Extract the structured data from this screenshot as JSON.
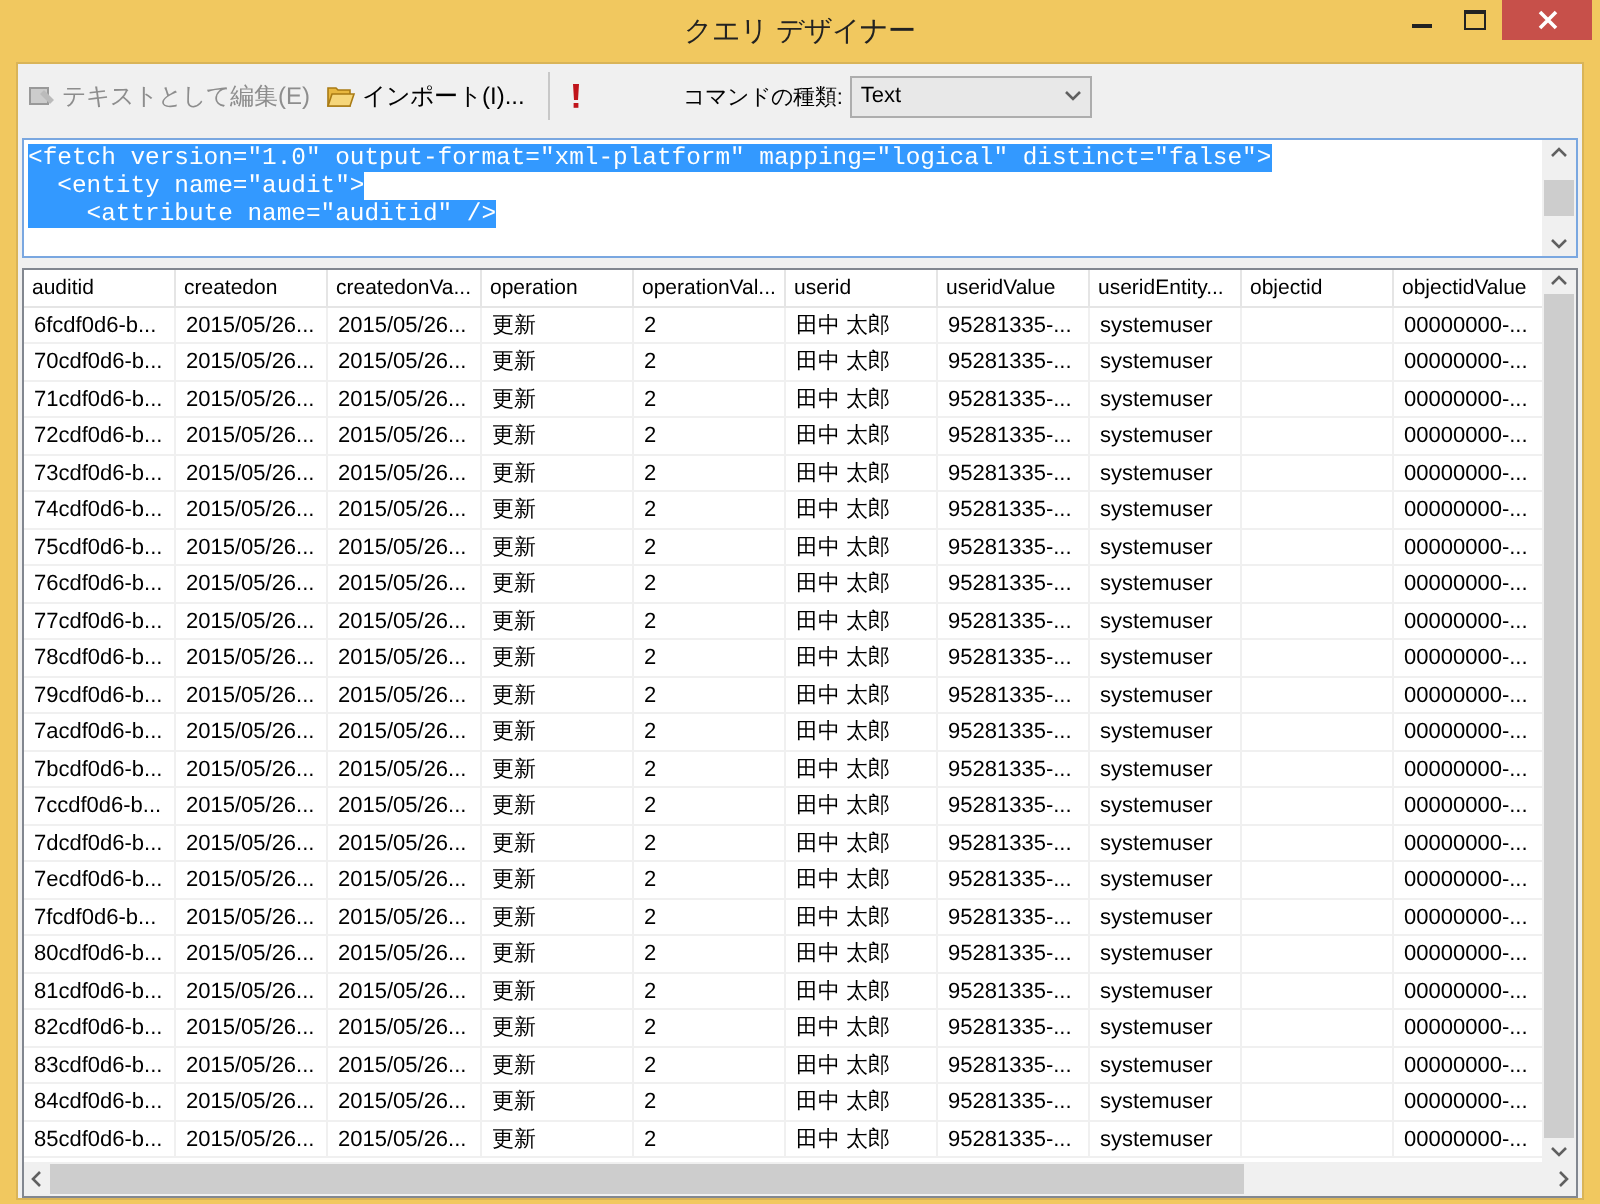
{
  "window": {
    "title": "クエリ デザイナー"
  },
  "toolbar": {
    "buttons": [
      {
        "label": "テキストとして編集(E)",
        "disabled": true
      },
      {
        "label": "インポート(I)...",
        "disabled": false
      }
    ],
    "command_type_label": "コマンドの種類:",
    "command_type_value": "Text"
  },
  "code_editor": {
    "selected": true,
    "lines": [
      "<fetch version=\"1.0\" output-format=\"xml-platform\" mapping=\"logical\" distinct=\"false\">",
      "  <entity name=\"audit\">",
      "    <attribute name=\"auditid\" />"
    ]
  },
  "table": {
    "columns": [
      "auditid",
      "createdon",
      "createdonVa...",
      "operation",
      "operationVal...",
      "userid",
      "useridValue",
      "useridEntity...",
      "objectid",
      "objectidValue"
    ],
    "rows": [
      [
        "6fcdf0d6-b...",
        "2015/05/26...",
        "2015/05/26...",
        "更新",
        "2",
        "田中 太郎",
        "95281335-...",
        "systemuser",
        "",
        "00000000-..."
      ],
      [
        "70cdf0d6-b...",
        "2015/05/26...",
        "2015/05/26...",
        "更新",
        "2",
        "田中 太郎",
        "95281335-...",
        "systemuser",
        "",
        "00000000-..."
      ],
      [
        "71cdf0d6-b...",
        "2015/05/26...",
        "2015/05/26...",
        "更新",
        "2",
        "田中 太郎",
        "95281335-...",
        "systemuser",
        "",
        "00000000-..."
      ],
      [
        "72cdf0d6-b...",
        "2015/05/26...",
        "2015/05/26...",
        "更新",
        "2",
        "田中 太郎",
        "95281335-...",
        "systemuser",
        "",
        "00000000-..."
      ],
      [
        "73cdf0d6-b...",
        "2015/05/26...",
        "2015/05/26...",
        "更新",
        "2",
        "田中 太郎",
        "95281335-...",
        "systemuser",
        "",
        "00000000-..."
      ],
      [
        "74cdf0d6-b...",
        "2015/05/26...",
        "2015/05/26...",
        "更新",
        "2",
        "田中 太郎",
        "95281335-...",
        "systemuser",
        "",
        "00000000-..."
      ],
      [
        "75cdf0d6-b...",
        "2015/05/26...",
        "2015/05/26...",
        "更新",
        "2",
        "田中 太郎",
        "95281335-...",
        "systemuser",
        "",
        "00000000-..."
      ],
      [
        "76cdf0d6-b...",
        "2015/05/26...",
        "2015/05/26...",
        "更新",
        "2",
        "田中 太郎",
        "95281335-...",
        "systemuser",
        "",
        "00000000-..."
      ],
      [
        "77cdf0d6-b...",
        "2015/05/26...",
        "2015/05/26...",
        "更新",
        "2",
        "田中 太郎",
        "95281335-...",
        "systemuser",
        "",
        "00000000-..."
      ],
      [
        "78cdf0d6-b...",
        "2015/05/26...",
        "2015/05/26...",
        "更新",
        "2",
        "田中 太郎",
        "95281335-...",
        "systemuser",
        "",
        "00000000-..."
      ],
      [
        "79cdf0d6-b...",
        "2015/05/26...",
        "2015/05/26...",
        "更新",
        "2",
        "田中 太郎",
        "95281335-...",
        "systemuser",
        "",
        "00000000-..."
      ],
      [
        "7acdf0d6-b...",
        "2015/05/26...",
        "2015/05/26...",
        "更新",
        "2",
        "田中 太郎",
        "95281335-...",
        "systemuser",
        "",
        "00000000-..."
      ],
      [
        "7bcdf0d6-b...",
        "2015/05/26...",
        "2015/05/26...",
        "更新",
        "2",
        "田中 太郎",
        "95281335-...",
        "systemuser",
        "",
        "00000000-..."
      ],
      [
        "7ccdf0d6-b...",
        "2015/05/26...",
        "2015/05/26...",
        "更新",
        "2",
        "田中 太郎",
        "95281335-...",
        "systemuser",
        "",
        "00000000-..."
      ],
      [
        "7dcdf0d6-b...",
        "2015/05/26...",
        "2015/05/26...",
        "更新",
        "2",
        "田中 太郎",
        "95281335-...",
        "systemuser",
        "",
        "00000000-..."
      ],
      [
        "7ecdf0d6-b...",
        "2015/05/26...",
        "2015/05/26...",
        "更新",
        "2",
        "田中 太郎",
        "95281335-...",
        "systemuser",
        "",
        "00000000-..."
      ],
      [
        "7fcdf0d6-b...",
        "2015/05/26...",
        "2015/05/26...",
        "更新",
        "2",
        "田中 太郎",
        "95281335-...",
        "systemuser",
        "",
        "00000000-..."
      ],
      [
        "80cdf0d6-b...",
        "2015/05/26...",
        "2015/05/26...",
        "更新",
        "2",
        "田中 太郎",
        "95281335-...",
        "systemuser",
        "",
        "00000000-..."
      ],
      [
        "81cdf0d6-b...",
        "2015/05/26...",
        "2015/05/26...",
        "更新",
        "2",
        "田中 太郎",
        "95281335-...",
        "systemuser",
        "",
        "00000000-..."
      ],
      [
        "82cdf0d6-b...",
        "2015/05/26...",
        "2015/05/26...",
        "更新",
        "2",
        "田中 太郎",
        "95281335-...",
        "systemuser",
        "",
        "00000000-..."
      ],
      [
        "83cdf0d6-b...",
        "2015/05/26...",
        "2015/05/26...",
        "更新",
        "2",
        "田中 太郎",
        "95281335-...",
        "systemuser",
        "",
        "00000000-..."
      ],
      [
        "84cdf0d6-b...",
        "2015/05/26...",
        "2015/05/26...",
        "更新",
        "2",
        "田中 太郎",
        "95281335-...",
        "systemuser",
        "",
        "00000000-..."
      ],
      [
        "85cdf0d6-b...",
        "2015/05/26...",
        "2015/05/26...",
        "更新",
        "2",
        "田中 太郎",
        "95281335-...",
        "systemuser",
        "",
        "00000000-..."
      ]
    ]
  }
}
